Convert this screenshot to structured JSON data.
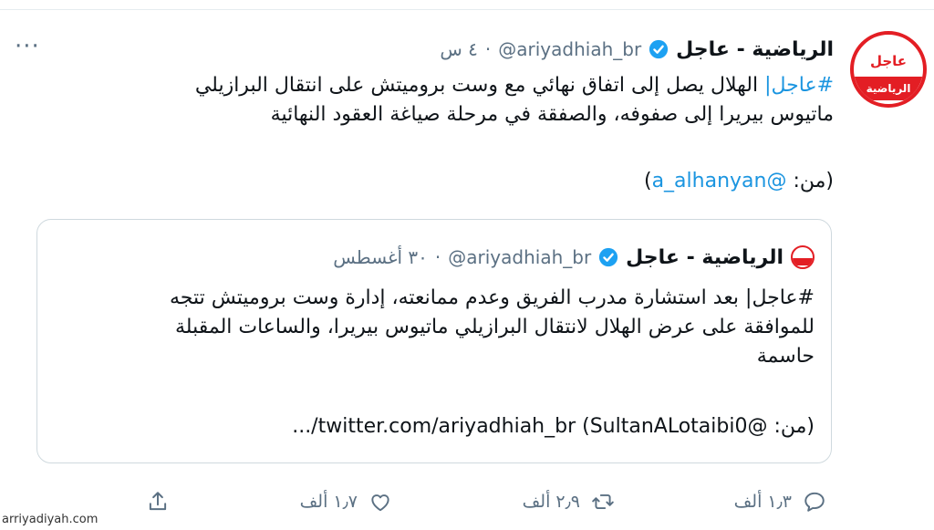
{
  "tweet": {
    "display_name": "الرياضية - عاجل",
    "handle": "@ariyadhiah_br",
    "separator": "·",
    "time": "٤ س",
    "text_hashtag": "#عاجل|",
    "text_line1_rest": " الهلال يصل إلى اتفاق نهائي مع وست بروميتش على انتقال البرازيلي",
    "text_line2": "ماتيوس بيريرا إلى صفوفه، والصفقة في مرحلة صياغة العقود النهائية",
    "credit_prefix": "(من: ",
    "credit_handle": "@a_alhanyan",
    "credit_suffix": ")"
  },
  "quoted": {
    "display_name": "الرياضية - عاجل",
    "handle": "@ariyadhiah_br",
    "separator": "·",
    "time": "٣٠ أغسطس",
    "line1": "#عاجل| بعد استشارة مدرب الفريق وعدم ممانعته، إدارة وست بروميتش تتجه",
    "line2": "للموافقة على عرض الهلال لانتقال البرازيلي ماتيوس بيريرا، والساعات المقبلة",
    "line3": "حاسمة",
    "credit": "(من: @SultanALotaibi0) twitter.com/ariyadhiah_br/..."
  },
  "actions": {
    "reply_count": "١٫٣ ألف",
    "retweet_count": "٢٫٩ ألف",
    "like_count": "١٫٧ ألف"
  },
  "more_label": "···",
  "watermark": "arriyadiyah.com",
  "colors": {
    "link": "#1b95e0",
    "muted": "#5b7083",
    "verified": "#1da1f2",
    "brand_red": "#e31e24"
  }
}
